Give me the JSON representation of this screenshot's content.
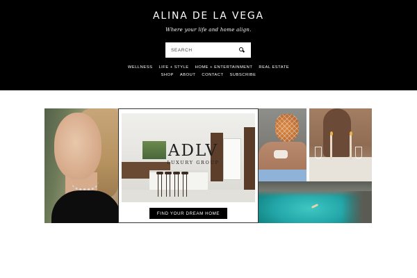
{
  "header": {
    "site_title": "ALINA DE LA VEGA",
    "tagline": "Where your life and home align."
  },
  "search": {
    "placeholder": "SEARCH",
    "icon": "search-icon"
  },
  "nav": {
    "row1": [
      "WELLNESS",
      "LIFE + STYLE",
      "HOME + ENTERTAINMENT",
      "REAL ESTATE"
    ],
    "row2": [
      "SHOP",
      "ABOUT",
      "CONTACT",
      "SUBSCRIBE"
    ]
  },
  "feature": {
    "logo_mark": "ADLV",
    "logo_sub": "LUXURY GROUP",
    "cta_label": "FIND YOUR DREAM HOME"
  },
  "colors": {
    "header_background": "#000000",
    "cta_background": "#000000",
    "page_background": "#ffffff"
  }
}
